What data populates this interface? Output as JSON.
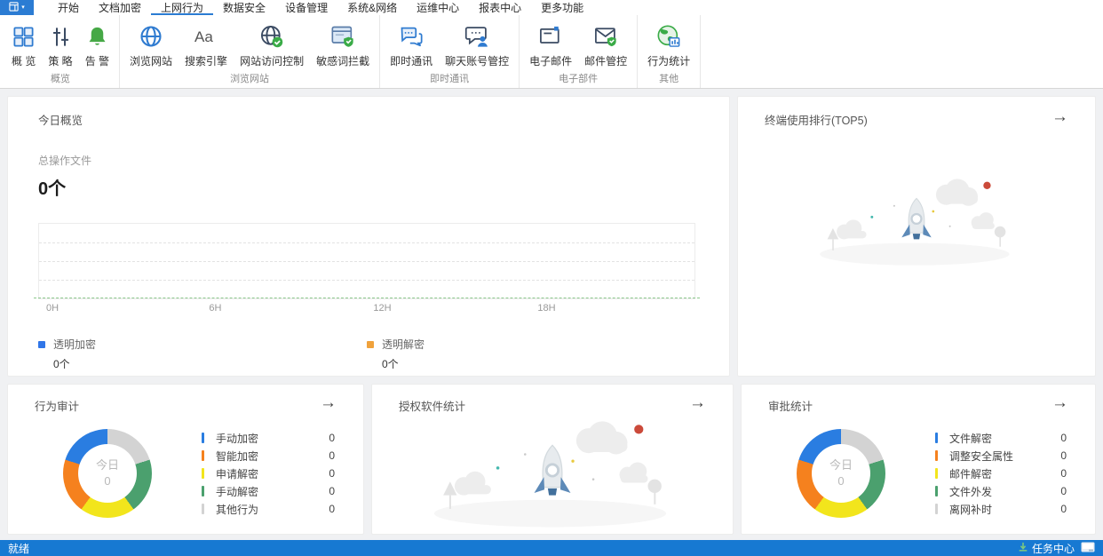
{
  "ui": {
    "arrow": "→",
    "caret": "▾"
  },
  "window": {
    "tabs": [
      {
        "label": "开始"
      },
      {
        "label": "文档加密"
      },
      {
        "label": "上网行为",
        "active": true
      },
      {
        "label": "数据安全"
      },
      {
        "label": "设备管理"
      },
      {
        "label": "系统&网络"
      },
      {
        "label": "运维中心"
      },
      {
        "label": "报表中心"
      },
      {
        "label": "更多功能"
      }
    ]
  },
  "ribbon": {
    "groups": [
      {
        "label": "概览",
        "items": [
          {
            "label": "概 览",
            "icon": "grid-icon"
          },
          {
            "label": "策 略",
            "icon": "sliders-icon"
          },
          {
            "label": "告 警",
            "icon": "bell-icon"
          }
        ]
      },
      {
        "label": "浏览网站",
        "items": [
          {
            "label": "浏览网站",
            "icon": "globe-icon"
          },
          {
            "label": "搜索引擎",
            "icon": "font-Aa-icon"
          },
          {
            "label": "网站访问控制",
            "icon": "globe-check-icon"
          },
          {
            "label": "敏感词拦截",
            "icon": "window-shield-icon"
          }
        ]
      },
      {
        "label": "即时通讯",
        "items": [
          {
            "label": "即时通讯",
            "icon": "chat-bubbles-icon"
          },
          {
            "label": "聊天账号管控",
            "icon": "chat-user-icon"
          }
        ]
      },
      {
        "label": "电子部件",
        "items": [
          {
            "label": "电子邮件",
            "icon": "envelope-icon"
          },
          {
            "label": "邮件管控",
            "icon": "envelope-shield-icon"
          }
        ]
      },
      {
        "label": "其他",
        "items": [
          {
            "label": "行为统计",
            "icon": "globe-chart-icon"
          }
        ]
      }
    ]
  },
  "cards": {
    "today": {
      "title": "今日概览",
      "metric_label": "总操作文件",
      "metric_value": "0个",
      "x_ticks": [
        "0H",
        "6H",
        "12H",
        "18H"
      ],
      "legend": [
        {
          "label": "透明加密",
          "value": "0个",
          "color": "#3076e8"
        },
        {
          "label": "透明解密",
          "value": "0个",
          "color": "#f0a23c"
        }
      ]
    },
    "terminal_rank": {
      "title": "终端使用排行(TOP5)"
    },
    "behavior_audit": {
      "title": "行为审计",
      "center_label": "今日",
      "center_value": "0",
      "legend": [
        {
          "label": "手动加密",
          "value": "0",
          "color": "#2a7de1"
        },
        {
          "label": "智能加密",
          "value": "0",
          "color": "#f5811e"
        },
        {
          "label": "申请解密",
          "value": "0",
          "color": "#f2e51c"
        },
        {
          "label": "手动解密",
          "value": "0",
          "color": "#4ba06e"
        },
        {
          "label": "其他行为",
          "value": "0",
          "color": "#d3d3d3"
        }
      ]
    },
    "software_stats": {
      "title": "授权软件统计"
    },
    "approval_stats": {
      "title": "审批统计",
      "center_label": "今日",
      "center_value": "0",
      "legend": [
        {
          "label": "文件解密",
          "value": "0",
          "color": "#2a7de1"
        },
        {
          "label": "调整安全属性",
          "value": "0",
          "color": "#f5811e"
        },
        {
          "label": "邮件解密",
          "value": "0",
          "color": "#f2e51c"
        },
        {
          "label": "文件外发",
          "value": "0",
          "color": "#4ba06e"
        },
        {
          "label": "离网补时",
          "value": "0",
          "color": "#d3d3d3"
        }
      ]
    }
  },
  "statusbar": {
    "left": "就绪",
    "task_center": "任务中心"
  },
  "colors": {
    "accent": "#2b7cd3",
    "statusbar": "#1779d2",
    "green": "#3aab47"
  },
  "chart_data": [
    {
      "type": "area",
      "title": "今日概览",
      "x_ticks": [
        "0H",
        "6H",
        "12H",
        "18H"
      ],
      "x_range_hours": [
        0,
        24
      ],
      "series": [
        {
          "name": "透明加密",
          "color": "#3076e8",
          "values": []
        },
        {
          "name": "透明解密",
          "color": "#f0a23c",
          "values": []
        }
      ],
      "grid": "dashed-horizontal",
      "legend_position": "bottom"
    },
    {
      "type": "pie",
      "title": "行为审计",
      "center_text": [
        "今日",
        "0"
      ],
      "categories": [
        "手动加密",
        "智能加密",
        "申请解密",
        "手动解密",
        "其他行为"
      ],
      "values": [
        0,
        0,
        0,
        0,
        0
      ],
      "colors": [
        "#2a7de1",
        "#f5811e",
        "#f2e51c",
        "#4ba06e",
        "#d3d3d3"
      ]
    },
    {
      "type": "pie",
      "title": "审批统计",
      "center_text": [
        "今日",
        "0"
      ],
      "categories": [
        "文件解密",
        "调整安全属性",
        "邮件解密",
        "文件外发",
        "离网补时"
      ],
      "values": [
        0,
        0,
        0,
        0,
        0
      ],
      "colors": [
        "#2a7de1",
        "#f5811e",
        "#f2e51c",
        "#4ba06e",
        "#d3d3d3"
      ]
    }
  ]
}
